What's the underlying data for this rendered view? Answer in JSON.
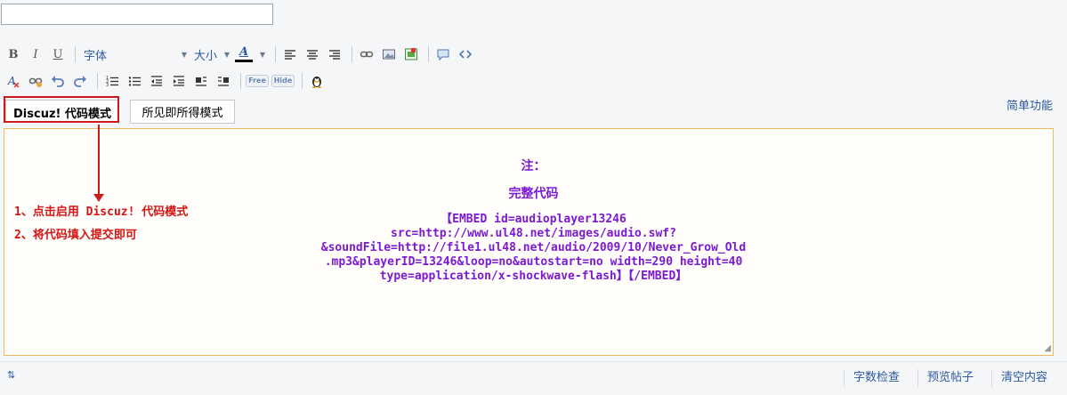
{
  "subject": {
    "value": ""
  },
  "toolbar": {
    "bold": "B",
    "italic": "I",
    "underline": "U",
    "font_select": "字体",
    "size_select": "大小",
    "text_color_letter": "A",
    "free_label": "Free",
    "hide_label": "Hide"
  },
  "modes": {
    "code_mode": "Discuz! 代码模式",
    "wysiwyg_mode": "所见即所得模式",
    "simple_link": "简单功能"
  },
  "editor": {
    "note_title": "注：",
    "note_subtitle": "完整代码",
    "code_lines": [
      "【EMBED id=audioplayer13246",
      "src=http://www.ul48.net/images/audio.swf?",
      "&soundFile=http://file1.ul48.net/audio/2009/10/Never_Grow_Old",
      ".mp3&playerID=13246&loop=no&autostart=no width=290 height=40",
      "type=application/x-shockwave-flash】【/EMBED】"
    ],
    "instructions": [
      "1、点击启用 Discuz! 代码模式",
      "2、将代码填入提交即可"
    ]
  },
  "statusbar": {
    "word_check": "字数检查",
    "preview": "预览帖子",
    "clear": "清空内容"
  },
  "colors": {
    "note_purple": "#7b19d4",
    "annotation_red": "#cc1b1b",
    "link_blue": "#2d5aa0",
    "editor_border": "#f0b860"
  }
}
